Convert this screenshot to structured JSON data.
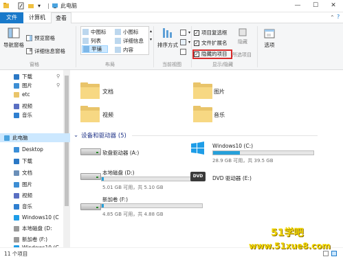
{
  "window": {
    "title": "此电脑",
    "buttons": {
      "minimize": "—",
      "maximize": "☐",
      "close": "✕"
    }
  },
  "tabs": [
    {
      "label": "文件"
    },
    {
      "label": "计算机"
    },
    {
      "label": "查看"
    }
  ],
  "ribbon": {
    "panes": {
      "nav_pane": "导航窗格",
      "preview_pane": "预览窗格",
      "details_pane": "详细信息窗格",
      "group": "窗格"
    },
    "layout": {
      "items": [
        "中图标",
        "小图标",
        "列表",
        "详细信息",
        "平铺",
        "内容"
      ],
      "group": "布局"
    },
    "current_view": {
      "sort": "排序方式",
      "group": "当前视图"
    },
    "show_hide": {
      "item_checkbox": "项目复选框",
      "file_ext": "文件扩展名",
      "hidden_items": "隐藏的项目",
      "hide_selected": "隐藏",
      "selected_items": "所选项目",
      "group": "显示/隐藏"
    },
    "options": "选项"
  },
  "nav": {
    "items": [
      {
        "label": "下载",
        "icon": "download-icon",
        "pinned": true
      },
      {
        "label": "图片",
        "icon": "pictures-icon",
        "pinned": true
      },
      {
        "label": "etc",
        "icon": "folder-icon",
        "pinned": false
      },
      {
        "label": "视频",
        "icon": "video-icon",
        "pinned": false
      },
      {
        "label": "音乐",
        "icon": "music-icon",
        "pinned": false
      },
      {
        "label": "此电脑",
        "icon": "computer-icon",
        "pinned": false
      },
      {
        "label": "Desktop",
        "icon": "desktop-icon",
        "pinned": false
      },
      {
        "label": "下载",
        "icon": "download-icon",
        "pinned": false
      },
      {
        "label": "文档",
        "icon": "documents-icon",
        "pinned": false
      },
      {
        "label": "图片",
        "icon": "pictures-icon",
        "pinned": false
      },
      {
        "label": "视频",
        "icon": "video-icon",
        "pinned": false
      },
      {
        "label": "音乐",
        "icon": "music-icon",
        "pinned": false
      },
      {
        "label": "Windows10 (C",
        "icon": "windows-drive-icon",
        "pinned": false
      },
      {
        "label": "本地磁盘 (D:",
        "icon": "drive-icon",
        "pinned": false
      },
      {
        "label": "新加卷 (F:)",
        "icon": "drive-icon",
        "pinned": false
      },
      {
        "label": "Windows10 (C",
        "icon": "windows-drive-icon",
        "pinned": false
      }
    ]
  },
  "folders": [
    {
      "label": "文档"
    },
    {
      "label": "图片"
    },
    {
      "label": "视频"
    },
    {
      "label": "音乐"
    }
  ],
  "devices": {
    "header": "设备和驱动器 (5)",
    "items": [
      {
        "name": "软盘驱动器 (A:)",
        "size": "",
        "used_fraction": null
      },
      {
        "name": "Windows10 (C:)",
        "size": "28.9 GB 可用，共 39.5 GB",
        "used_fraction": 0.27
      },
      {
        "name": "本地磁盘 (D:)",
        "size": "5.01 GB 可用，共 5.10 GB",
        "used_fraction": 0.02
      },
      {
        "name": "DVD 驱动器 (E:)",
        "size": "",
        "used_fraction": null
      },
      {
        "name": "新加卷 (F:)",
        "size": "4.85 GB 可用，共 4.88 GB",
        "used_fraction": 0.01
      }
    ]
  },
  "status": {
    "count": "11 个项目"
  },
  "watermark": {
    "brand": "51学吧",
    "url": "www.51xue8.com"
  },
  "colors": {
    "accent": "#1979ca",
    "selection": "#cce8ff",
    "drive_bar": "#26a0da",
    "highlight_box": "#d92b2b"
  }
}
